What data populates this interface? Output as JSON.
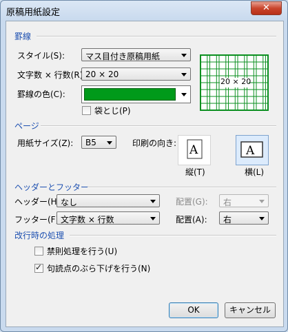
{
  "window": {
    "title": "原稿用紙設定",
    "close_glyph": "✕"
  },
  "sections": {
    "ruled_lines": "罫線",
    "page": "ページ",
    "header_footer": "ヘッダーとフッター",
    "line_break": "改行時の処理"
  },
  "ruled": {
    "style_label": "スタイル(S):",
    "style_value": "マス目付き原稿用紙",
    "chars_lines_label": "文字数 × 行数(R):",
    "chars_lines_value": "20 × 20",
    "color_label": "罫線の色(C):",
    "color_value": "#009a1a",
    "fold_label": "袋とじ(P)",
    "fold_checked": false,
    "preview_text": "20 × 20"
  },
  "page": {
    "paper_size_label": "用紙サイズ(Z):",
    "paper_size_value": "B5",
    "orientation_label": "印刷の向き:",
    "portrait_label": "縦(T)",
    "landscape_label": "横(L)",
    "orientation_selected": "landscape"
  },
  "header_footer": {
    "header_label": "ヘッダー(H):",
    "header_value": "なし",
    "header_position_label": "配置(G):",
    "header_position_value": "右",
    "footer_label": "フッター(F):",
    "footer_value": "文字数 × 行数",
    "footer_position_label": "配置(A):",
    "footer_position_value": "右"
  },
  "line_break": {
    "kinsoku_label": "禁則処理を行う(U)",
    "kinsoku_checked": false,
    "punctuation_label": "句読点のぶら下げを行う(N)",
    "punctuation_checked": true
  },
  "buttons": {
    "ok": "OK",
    "cancel": "キャンセル"
  }
}
